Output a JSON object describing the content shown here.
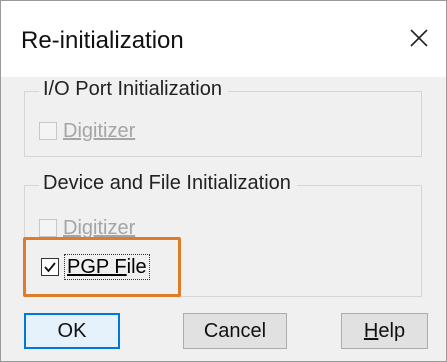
{
  "window": {
    "title": "Re-initialization",
    "close_glyph": "close-icon"
  },
  "io_group": {
    "label": "I/O Port Initialization",
    "digitizer": {
      "label": "Digitizer",
      "checked": false,
      "enabled": false
    }
  },
  "device_group": {
    "label": "Device and File Initialization",
    "digitizer": {
      "label": "Digitizer",
      "checked": false,
      "enabled": false
    },
    "pgp_file": {
      "label_underlined": "PGP F",
      "label_rest": "ile",
      "checked": true,
      "enabled": true
    }
  },
  "buttons": {
    "ok": "OK",
    "cancel": "Cancel",
    "help_underlined": "H",
    "help_rest": "elp"
  },
  "colors": {
    "highlight": "#e07b2a",
    "default_button_border": "#0078d7",
    "disabled_text": "#a5a5a5"
  }
}
